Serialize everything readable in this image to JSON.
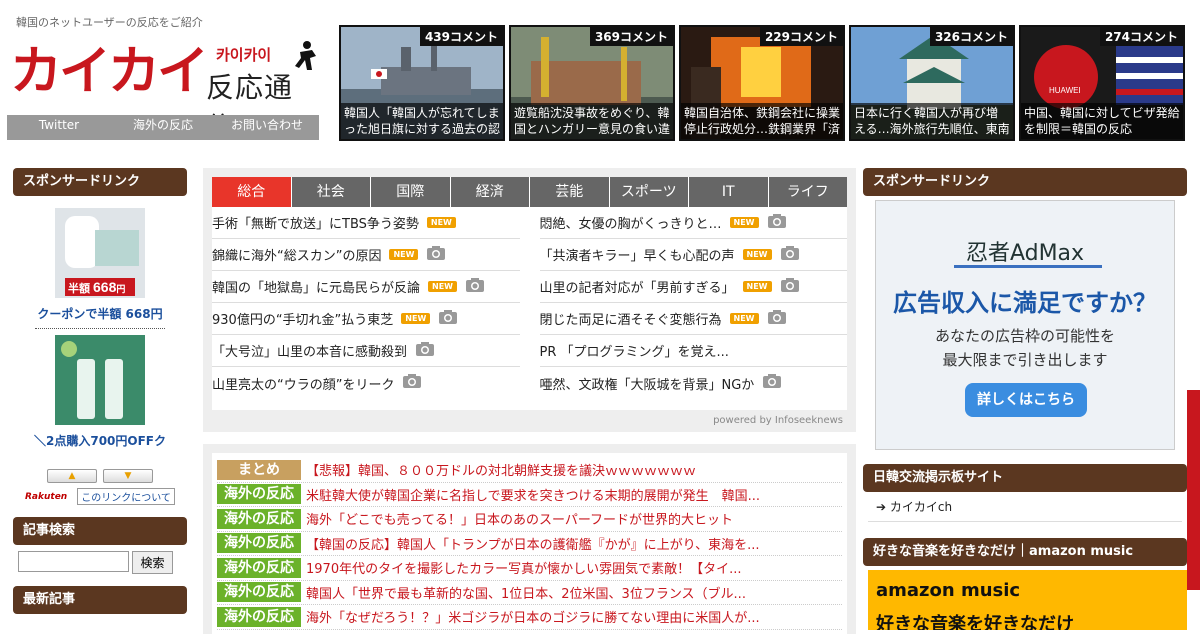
{
  "header": {
    "tagline": "韓国のネットユーザーの反応をご紹介",
    "logo_main": "カイカイ",
    "logo_kana": "카이카이",
    "logo_sub": "反応通信"
  },
  "topnav": [
    "Twitter",
    "海外の反応",
    "お問い合わせ"
  ],
  "thumbs": [
    {
      "count": "439コメント",
      "caption": "韓国人「韓国人が忘れてしまった旭日旗に対する過去の認"
    },
    {
      "count": "369コメント",
      "caption": "遊覧船沈没事故をめぐり、韓国とハンガリー意見の食い違"
    },
    {
      "count": "229コメント",
      "caption": "韓国自治体、鉄鋼会社に操業停止行政処分…鉄鋼業界「済"
    },
    {
      "count": "326コメント",
      "caption": "日本に行く韓国人が再び増える…海外旅行先順位、東南ア"
    },
    {
      "count": "274コメント",
      "caption": "中国、韓国に対してビザ発給を制限＝韓国の反応",
      "logo": "HUAWEI"
    }
  ],
  "left": {
    "sponsor_title": "スポンサードリンク",
    "ad1_price_label": "半額",
    "ad1_price": "668",
    "ad1_price_unit": "円",
    "ad1_text": "クーポンで半額 668円",
    "ad2_text": "＼2点購入700円OFFク",
    "rakuten": "Rakuten",
    "link_about": "このリンクについて",
    "search_title": "記事検索",
    "search_button": "検索",
    "recent_title": "最新記事"
  },
  "tabs": [
    "総合",
    "社会",
    "国際",
    "経済",
    "芸能",
    "スポーツ",
    "IT",
    "ライフ"
  ],
  "news_left": [
    {
      "text": "手術「無断で放送」にTBS争う姿勢",
      "new": true,
      "cam": false
    },
    {
      "text": "錦織に海外“総スカン”の原因",
      "new": true,
      "cam": true
    },
    {
      "text": "韓国の「地獄島」に元島民らが反論",
      "new": true,
      "cam": true
    },
    {
      "text": "930億円の“手切れ金”払う東芝",
      "new": true,
      "cam": true
    },
    {
      "text": "「大号泣」山里の本音に感動殺到",
      "new": false,
      "cam": true
    },
    {
      "text": "山里亮太の“ウラの顔”をリーク",
      "new": false,
      "cam": true
    }
  ],
  "news_right": [
    {
      "text": "悶絶、女優の胸がくっきりと…",
      "new": true,
      "cam": true
    },
    {
      "text": "「共演者キラー」早くも心配の声",
      "new": true,
      "cam": true
    },
    {
      "text": "山里の記者対応が「男前すぎる」",
      "new": true,
      "cam": true
    },
    {
      "text": "閉じた両足に酒そそぐ変態行為",
      "new": true,
      "cam": true
    },
    {
      "text": "PR 「プログラミング」を覚え...",
      "new": false,
      "cam": false
    },
    {
      "text": "唖然、文政権「大阪城を背景」NGか",
      "new": false,
      "cam": true
    }
  ],
  "new_label": "NEW",
  "powered": "powered by Infoseeknews",
  "list": [
    {
      "badge": "まとめ",
      "kind": "mat",
      "text": "【悲報】韓国、８００万ドルの対北朝鮮支援を議決ｗｗｗｗｗｗｗ"
    },
    {
      "badge": "海外の反応",
      "kind": "kai",
      "text": "米駐韓大使が韓国企業に名指しで要求を突きつける末期的展開が発生　韓国..."
    },
    {
      "badge": "海外の反応",
      "kind": "kai",
      "text": "海外「どこでも売ってる！」日本のあのスーパーフードが世界的大ヒット"
    },
    {
      "badge": "海外の反応",
      "kind": "kai",
      "text": "【韓国の反応】韓国人「トランプが日本の護衛艦『かが』に上がり、東海を..."
    },
    {
      "badge": "海外の反応",
      "kind": "kai",
      "text": "1970年代のタイを撮影したカラー写真が懐かしい雰囲気で素敵！【タイ..."
    },
    {
      "badge": "海外の反応",
      "kind": "kai",
      "text": "韓国人「世界で最も革新的な国、1位日本、2位米国、3位フランス（ブル..."
    },
    {
      "badge": "海外の反応",
      "kind": "kai",
      "text": "海外「なぜだろう！？」米ゴジラが日本のゴジラに勝てない理由に米国人が..."
    }
  ],
  "right": {
    "sponsor_title": "スポンサードリンク",
    "ad_brand": "忍者AdMax",
    "ad_head": "広告収入に満足ですか？",
    "ad_s1": "あなたの広告枠の可能性を",
    "ad_s2": "最大限まで引き出します",
    "ad_btn": "詳しくはこちら",
    "board_title": "日韓交流掲示板サイト",
    "board_link": "カイカイch",
    "music_title": "好きな音楽を好きなだけ｜amazon music",
    "amz1": "amazon music",
    "amz2": "好きな音楽を好きなだけ"
  },
  "colors": {
    "brand_red": "#c8171e",
    "header_brown": "#5b3720",
    "tab_active": "#e8352a",
    "badge_green": "#6bb22a",
    "badge_tan": "#c8a060"
  }
}
